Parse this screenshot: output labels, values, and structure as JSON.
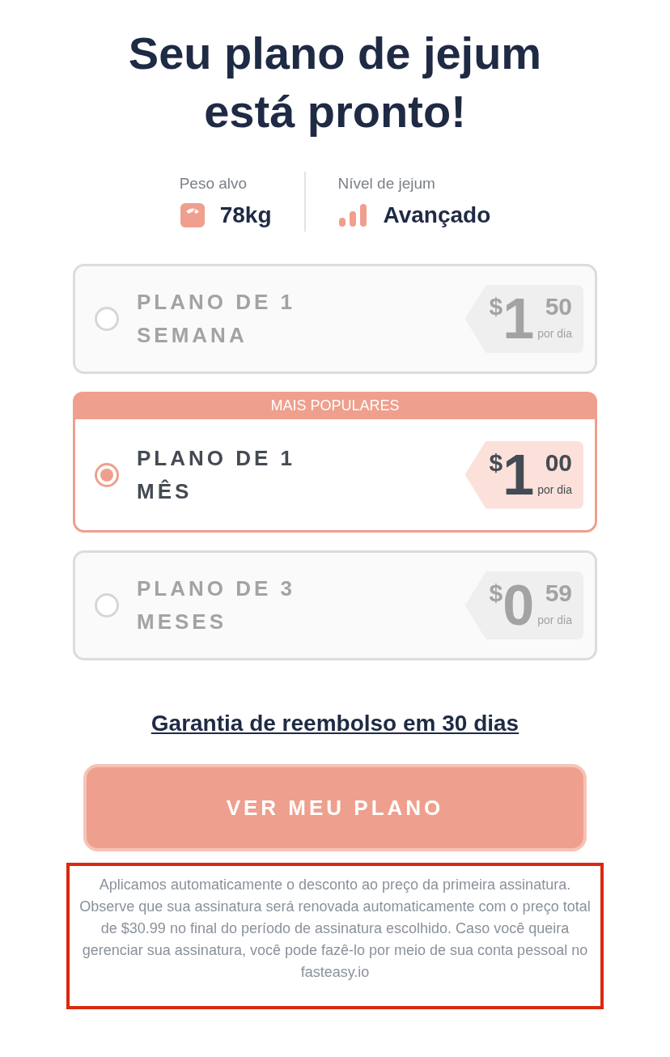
{
  "title": "Seu plano de jejum está pronto!",
  "stats": [
    {
      "kind": "weight",
      "label": "Peso alvo",
      "value": "78kg"
    },
    {
      "kind": "level",
      "label": "Nível de jejum",
      "value": "Avançado"
    }
  ],
  "plans": [
    {
      "name": "PLANO DE 1 SEMANA",
      "selected": false,
      "currency": "$",
      "whole": "1",
      "cents": "50",
      "unit": "por dia"
    },
    {
      "name": "PLANO DE 1 MÊS",
      "selected": true,
      "badge": "MAIS POPULARES",
      "currency": "$",
      "whole": "1",
      "cents": "00",
      "unit": "por dia"
    },
    {
      "name": "PLANO DE 3 MESES",
      "selected": false,
      "currency": "$",
      "whole": "0",
      "cents": "59",
      "unit": "por dia"
    }
  ],
  "guarantee_link": "Garantia de reembolso em 30 dias",
  "cta_button": "VER MEU PLANO",
  "disclaimer": "Aplicamos automaticamente o desconto ao preço da primeira assinatura. Observe que sua assinatura será renovada automaticamente com o preço total de $30.99 no final do período de assinatura escolhido. Caso você queira gerenciar sua assinatura, você pode fazê-lo por meio de sua conta pessoal no fasteasy.io"
}
